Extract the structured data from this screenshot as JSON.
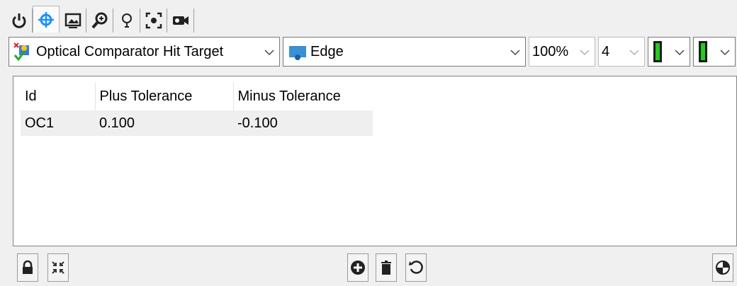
{
  "tabs": [
    {
      "icon": "power-icon"
    },
    {
      "icon": "crosshair-icon",
      "active": true
    },
    {
      "icon": "image-icon"
    },
    {
      "icon": "zoom-icon"
    },
    {
      "icon": "lightbulb-icon"
    },
    {
      "icon": "focus-icon"
    },
    {
      "icon": "camera-icon"
    }
  ],
  "toolbar": {
    "tool_select": {
      "icon": "optical-comparator-icon",
      "value": "Optical Comparator Hit Target"
    },
    "edge_select": {
      "icon": "edge-icon",
      "value": "Edge"
    },
    "zoom_select": {
      "value": "100%"
    },
    "count_select": {
      "value": "4"
    },
    "color1_select": {
      "icon": "green-bar-icon",
      "color": "#22cc22"
    },
    "color2_select": {
      "icon": "green-bar-icon",
      "color": "#22cc22"
    }
  },
  "table": {
    "columns": [
      "Id",
      "Plus Tolerance",
      "Minus Tolerance"
    ],
    "rows": [
      [
        "OC1",
        "0.100",
        "-0.100"
      ]
    ]
  },
  "bottom": {
    "left_buttons": [
      {
        "icon": "lock-icon"
      },
      {
        "icon": "collapse-icon"
      }
    ],
    "center_buttons": [
      {
        "icon": "add-icon"
      },
      {
        "icon": "delete-icon"
      },
      {
        "icon": "refresh-icon"
      }
    ],
    "right_buttons": [
      {
        "icon": "palette-icon"
      }
    ]
  }
}
